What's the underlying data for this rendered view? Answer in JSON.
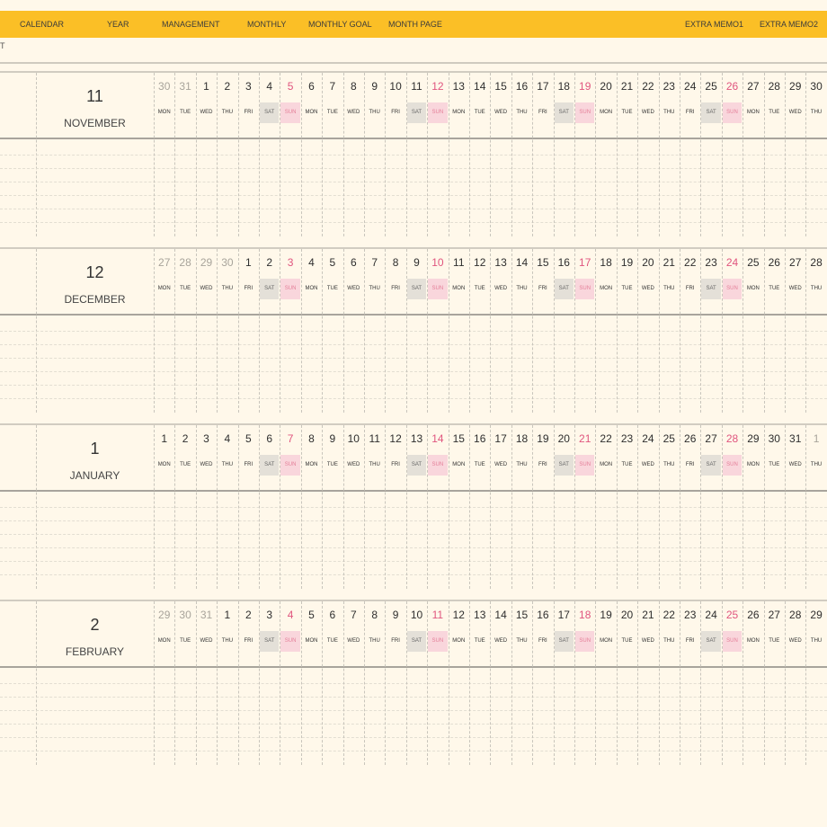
{
  "nav": {
    "items": [
      {
        "label": "CALENDAR"
      },
      {
        "label": "YEAR"
      },
      {
        "label": "MANAGEMENT"
      },
      {
        "label": "MONTHLY"
      },
      {
        "label": "MONTHLY GOAL"
      },
      {
        "label": "MONTH PAGE"
      },
      {
        "label": "EXTRA MEMO1"
      },
      {
        "label": "EXTRA MEMO2"
      }
    ],
    "color": "#fbbf26"
  },
  "stub_text": "T",
  "colors": {
    "sunday": "#e0557e",
    "saturday_bg": "#e4e0d8",
    "sunday_bg": "#f9d6dc"
  },
  "months": [
    {
      "number": "11",
      "name": "NOVEMBER",
      "days": [
        {
          "n": "30",
          "w": "MON",
          "muted": true
        },
        {
          "n": "31",
          "w": "TUE",
          "muted": true
        },
        {
          "n": "1",
          "w": "WED"
        },
        {
          "n": "2",
          "w": "THU"
        },
        {
          "n": "3",
          "w": "FRI"
        },
        {
          "n": "4",
          "w": "SAT"
        },
        {
          "n": "5",
          "w": "SUN"
        },
        {
          "n": "6",
          "w": "MON"
        },
        {
          "n": "7",
          "w": "TUE"
        },
        {
          "n": "8",
          "w": "WED"
        },
        {
          "n": "9",
          "w": "THU"
        },
        {
          "n": "10",
          "w": "FRI"
        },
        {
          "n": "11",
          "w": "SAT"
        },
        {
          "n": "12",
          "w": "SUN"
        },
        {
          "n": "13",
          "w": "MON"
        },
        {
          "n": "14",
          "w": "TUE"
        },
        {
          "n": "15",
          "w": "WED"
        },
        {
          "n": "16",
          "w": "THU"
        },
        {
          "n": "17",
          "w": "FRI"
        },
        {
          "n": "18",
          "w": "SAT"
        },
        {
          "n": "19",
          "w": "SUN"
        },
        {
          "n": "20",
          "w": "MON"
        },
        {
          "n": "21",
          "w": "TUE"
        },
        {
          "n": "22",
          "w": "WED"
        },
        {
          "n": "23",
          "w": "THU"
        },
        {
          "n": "24",
          "w": "FRI"
        },
        {
          "n": "25",
          "w": "SAT"
        },
        {
          "n": "26",
          "w": "SUN"
        },
        {
          "n": "27",
          "w": "MON"
        },
        {
          "n": "28",
          "w": "TUE"
        },
        {
          "n": "29",
          "w": "WED"
        },
        {
          "n": "30",
          "w": "THU"
        }
      ]
    },
    {
      "number": "12",
      "name": "DECEMBER",
      "days": [
        {
          "n": "27",
          "w": "MON",
          "muted": true
        },
        {
          "n": "28",
          "w": "TUE",
          "muted": true
        },
        {
          "n": "29",
          "w": "WED",
          "muted": true
        },
        {
          "n": "30",
          "w": "THU",
          "muted": true
        },
        {
          "n": "1",
          "w": "FRI"
        },
        {
          "n": "2",
          "w": "SAT"
        },
        {
          "n": "3",
          "w": "SUN"
        },
        {
          "n": "4",
          "w": "MON"
        },
        {
          "n": "5",
          "w": "TUE"
        },
        {
          "n": "6",
          "w": "WED"
        },
        {
          "n": "7",
          "w": "THU"
        },
        {
          "n": "8",
          "w": "FRI"
        },
        {
          "n": "9",
          "w": "SAT"
        },
        {
          "n": "10",
          "w": "SUN"
        },
        {
          "n": "11",
          "w": "MON"
        },
        {
          "n": "12",
          "w": "TUE"
        },
        {
          "n": "13",
          "w": "WED"
        },
        {
          "n": "14",
          "w": "THU"
        },
        {
          "n": "15",
          "w": "FRI"
        },
        {
          "n": "16",
          "w": "SAT"
        },
        {
          "n": "17",
          "w": "SUN"
        },
        {
          "n": "18",
          "w": "MON"
        },
        {
          "n": "19",
          "w": "TUE"
        },
        {
          "n": "20",
          "w": "WED"
        },
        {
          "n": "21",
          "w": "THU"
        },
        {
          "n": "22",
          "w": "FRI"
        },
        {
          "n": "23",
          "w": "SAT"
        },
        {
          "n": "24",
          "w": "SUN"
        },
        {
          "n": "25",
          "w": "MON"
        },
        {
          "n": "26",
          "w": "TUE"
        },
        {
          "n": "27",
          "w": "WED"
        },
        {
          "n": "28",
          "w": "THU"
        }
      ]
    },
    {
      "number": "1",
      "name": "JANUARY",
      "days": [
        {
          "n": "1",
          "w": "MON"
        },
        {
          "n": "2",
          "w": "TUE"
        },
        {
          "n": "3",
          "w": "WED"
        },
        {
          "n": "4",
          "w": "THU"
        },
        {
          "n": "5",
          "w": "FRI"
        },
        {
          "n": "6",
          "w": "SAT"
        },
        {
          "n": "7",
          "w": "SUN"
        },
        {
          "n": "8",
          "w": "MON"
        },
        {
          "n": "9",
          "w": "TUE"
        },
        {
          "n": "10",
          "w": "WED"
        },
        {
          "n": "11",
          "w": "THU"
        },
        {
          "n": "12",
          "w": "FRI"
        },
        {
          "n": "13",
          "w": "SAT"
        },
        {
          "n": "14",
          "w": "SUN"
        },
        {
          "n": "15",
          "w": "MON"
        },
        {
          "n": "16",
          "w": "TUE"
        },
        {
          "n": "17",
          "w": "WED"
        },
        {
          "n": "18",
          "w": "THU"
        },
        {
          "n": "19",
          "w": "FRI"
        },
        {
          "n": "20",
          "w": "SAT"
        },
        {
          "n": "21",
          "w": "SUN"
        },
        {
          "n": "22",
          "w": "MON"
        },
        {
          "n": "23",
          "w": "TUE"
        },
        {
          "n": "24",
          "w": "WED"
        },
        {
          "n": "25",
          "w": "THU"
        },
        {
          "n": "26",
          "w": "FRI"
        },
        {
          "n": "27",
          "w": "SAT"
        },
        {
          "n": "28",
          "w": "SUN"
        },
        {
          "n": "29",
          "w": "MON"
        },
        {
          "n": "30",
          "w": "TUE"
        },
        {
          "n": "31",
          "w": "WED"
        },
        {
          "n": "1",
          "w": "THU",
          "muted": true
        }
      ]
    },
    {
      "number": "2",
      "name": "FEBRUARY",
      "days": [
        {
          "n": "29",
          "w": "MON",
          "muted": true
        },
        {
          "n": "30",
          "w": "TUE",
          "muted": true
        },
        {
          "n": "31",
          "w": "WED",
          "muted": true
        },
        {
          "n": "1",
          "w": "THU"
        },
        {
          "n": "2",
          "w": "FRI"
        },
        {
          "n": "3",
          "w": "SAT"
        },
        {
          "n": "4",
          "w": "SUN"
        },
        {
          "n": "5",
          "w": "MON"
        },
        {
          "n": "6",
          "w": "TUE"
        },
        {
          "n": "7",
          "w": "WED"
        },
        {
          "n": "8",
          "w": "THU"
        },
        {
          "n": "9",
          "w": "FRI"
        },
        {
          "n": "10",
          "w": "SAT"
        },
        {
          "n": "11",
          "w": "SUN"
        },
        {
          "n": "12",
          "w": "MON"
        },
        {
          "n": "13",
          "w": "TUE"
        },
        {
          "n": "14",
          "w": "WED"
        },
        {
          "n": "15",
          "w": "THU"
        },
        {
          "n": "16",
          "w": "FRI"
        },
        {
          "n": "17",
          "w": "SAT"
        },
        {
          "n": "18",
          "w": "SUN"
        },
        {
          "n": "19",
          "w": "MON"
        },
        {
          "n": "20",
          "w": "TUE"
        },
        {
          "n": "21",
          "w": "WED"
        },
        {
          "n": "22",
          "w": "THU"
        },
        {
          "n": "23",
          "w": "FRI"
        },
        {
          "n": "24",
          "w": "SAT"
        },
        {
          "n": "25",
          "w": "SUN"
        },
        {
          "n": "26",
          "w": "MON"
        },
        {
          "n": "27",
          "w": "TUE"
        },
        {
          "n": "28",
          "w": "WED"
        },
        {
          "n": "29",
          "w": "THU"
        }
      ]
    }
  ]
}
